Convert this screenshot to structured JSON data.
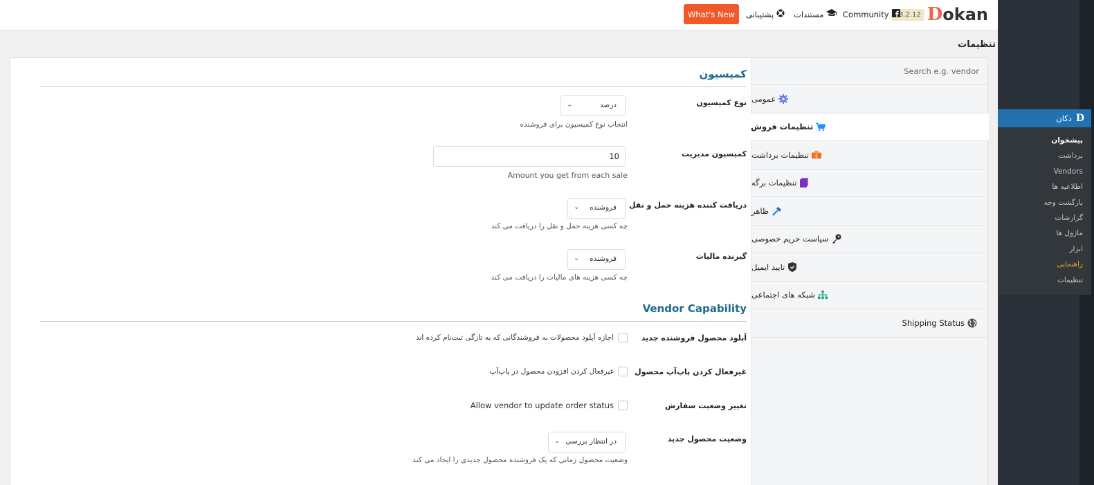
{
  "topbar": {
    "brand_version": "v3.2.12",
    "brand_d": "D",
    "brand_rest": "okan",
    "community": "Community",
    "docs": "مستندات",
    "support": "پشتیبانی",
    "whats_new": "What's New"
  },
  "page_title": "تنظیمات",
  "admin_menu": {
    "head": "دکان",
    "items": [
      "پیشخوان",
      "برداشت",
      "Vendors",
      "اطلاعیه ها",
      "بازگشت وجه",
      "گزارشات",
      "ماژول ها",
      "ابزار",
      "راهنمایی",
      "تنظیمات"
    ]
  },
  "nav": {
    "search_placeholder": "Search e.g. vendor",
    "items": [
      "عمومی",
      "تنظیمات فروش",
      "تنظیمات برداشت",
      "تنظیمات برگه",
      "ظاهر",
      "سیاست حریم خصوصی",
      "تایید ایمیل",
      "شبکه های اجتماعی",
      "Shipping Status"
    ]
  },
  "form": {
    "commission_title": "کمیسیون",
    "commission_type_label": "نوع کمیسیون",
    "commission_type_value": "درصد",
    "commission_type_help": "انتخاب نوع کمیسیون برای فروشنده",
    "admin_commission_label": "کمیسیون مدیریت",
    "admin_commission_value": "10",
    "admin_commission_help": "Amount you get from each sale",
    "shipping_label": "دریافت کننده هزینه حمل و نقل",
    "shipping_value": "فروشنده",
    "shipping_help": "چه کسی هزینه حمل و نقل را دریافت می کند",
    "tax_label": "گیرنده مالیات",
    "tax_value": "فروشنده",
    "tax_help": "چه کسی هزینه های مالیات را دریافت می کند",
    "capability_title": "Vendor Capability",
    "new_upload_label": "آپلود محصول فروشنده جدید",
    "new_upload_text": "اجازه آپلود محصولات به فروشندگانی که به تازگی ثبت‌نام کرده اند",
    "popup_label": "غیرفعال کردن پاپ‌آپ محصول",
    "popup_text": "غیرفعال کردن افزودن محصول در پاپ‌آپ",
    "order_status_label": "تغییر وضعیت سفارش",
    "order_status_text": "Allow vendor to update order status",
    "new_status_label": "وضعیت محصول جدید",
    "new_status_value": "در انتظار بررسی",
    "new_status_help": "وضعیت محصول زمانی که یک فروشنده محصول جدیدی را ایجاد می کند"
  }
}
